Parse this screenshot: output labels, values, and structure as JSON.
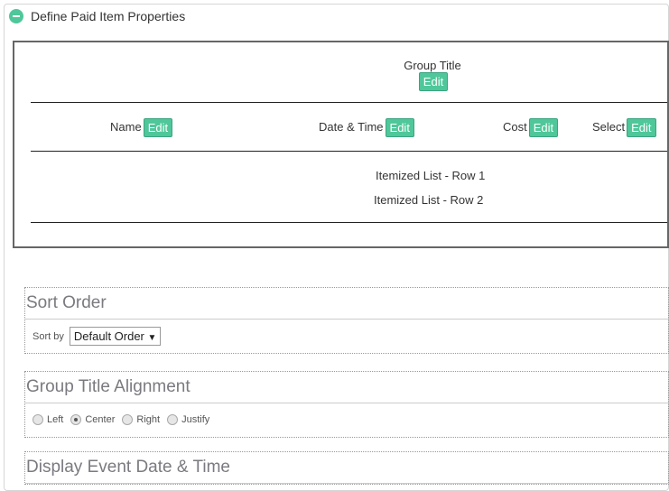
{
  "panel": {
    "title": "Define Paid Item Properties",
    "icon": "minus-circle-icon",
    "accent": "#4fc79a"
  },
  "preview": {
    "group_title": "Group Title",
    "edit_label": "Edit",
    "columns": [
      {
        "label": "Name"
      },
      {
        "label": "Date & Time"
      },
      {
        "label": "Cost"
      },
      {
        "label": "Select"
      }
    ],
    "rows": [
      "Itemized List - Row 1",
      "Itemized List - Row 2"
    ]
  },
  "sort_order": {
    "title": "Sort Order",
    "label": "Sort by",
    "value": "Default Order"
  },
  "alignment": {
    "title": "Group Title Alignment",
    "options": [
      "Left",
      "Center",
      "Right",
      "Justify"
    ],
    "selected": "Center"
  },
  "display_date": {
    "title": "Display Event Date & Time"
  }
}
